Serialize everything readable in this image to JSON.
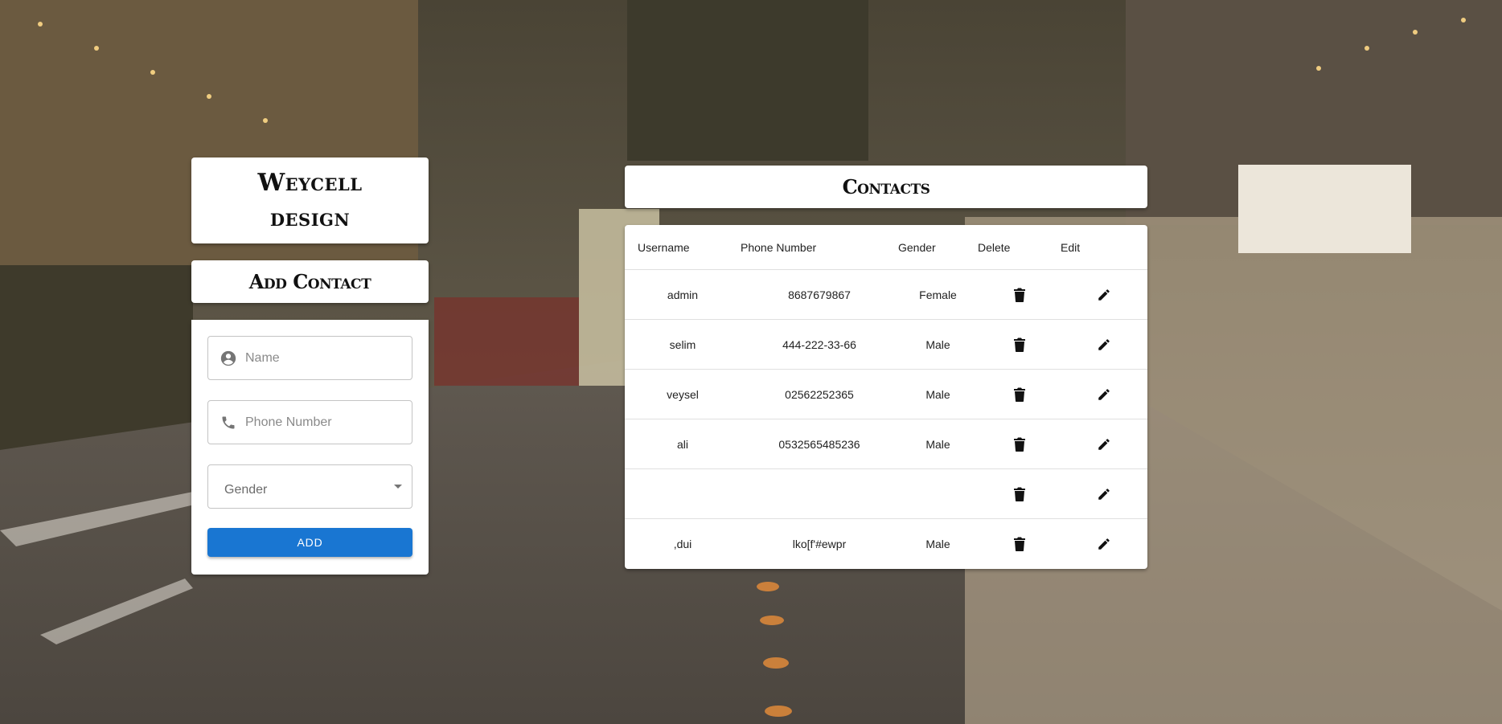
{
  "brand": {
    "line1": "Weycell",
    "line2": "design"
  },
  "add_contact": {
    "title": "Add Contact",
    "name_placeholder": "Name",
    "phone_placeholder": "Phone Number",
    "gender_label": "Gender",
    "add_button": "ADD"
  },
  "contacts": {
    "title": "Contacts",
    "columns": [
      "Username",
      "Phone Number",
      "Gender",
      "Delete",
      "Edit"
    ],
    "rows": [
      {
        "username": "admin",
        "phone": "8687679867",
        "gender": "Female"
      },
      {
        "username": "selim",
        "phone": "444-222-33-66",
        "gender": "Male"
      },
      {
        "username": "veysel",
        "phone": "02562252365",
        "gender": "Male"
      },
      {
        "username": "ali",
        "phone": "0532565485236",
        "gender": "Male"
      },
      {
        "username": "",
        "phone": "",
        "gender": ""
      },
      {
        "username": ",dui",
        "phone": "lko[f'#ewpr",
        "gender": "Male"
      }
    ]
  },
  "icons": {
    "name": "account-circle-icon",
    "phone": "phone-icon",
    "delete": "trash-icon",
    "edit": "pencil-icon",
    "dropdown": "caret-down-icon"
  },
  "colors": {
    "accent": "#1976d2",
    "card": "#ffffff",
    "text": "#222222"
  }
}
